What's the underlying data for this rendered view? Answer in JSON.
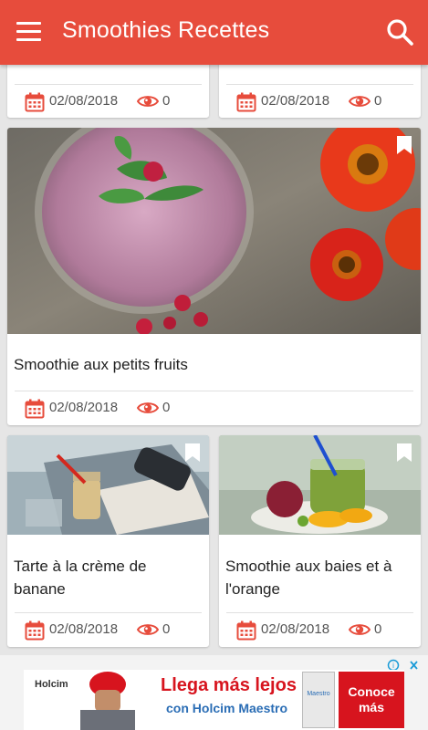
{
  "app": {
    "title": "Smoothies Recettes"
  },
  "cards": [
    {
      "title": "",
      "date": "02/08/2018",
      "views": "0"
    },
    {
      "title": "",
      "date": "02/08/2018",
      "views": "0"
    },
    {
      "title": "Smoothie aux petits fruits",
      "date": "02/08/2018",
      "views": "0"
    },
    {
      "title": "Tarte à la crème de banane",
      "date": "02/08/2018",
      "views": "0"
    },
    {
      "title": "Smoothie aux baies et à l'orange",
      "date": "02/08/2018",
      "views": "0"
    }
  ],
  "ad": {
    "brand": "Holcim",
    "headline_1": "Llega más lejos",
    "headline_2": "con Holcim Maestro",
    "cta": "Conoce más",
    "product": "Maestro"
  },
  "colors": {
    "appbar": "#e74c3c",
    "accent_icon": "#e74c3c",
    "ad_red": "#d7141e"
  }
}
